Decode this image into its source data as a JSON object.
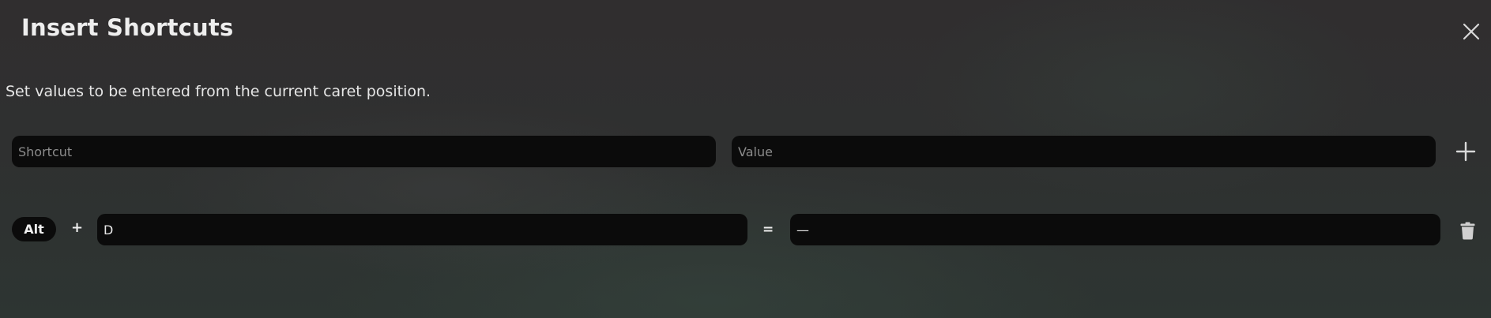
{
  "dialog": {
    "title": "Insert Shortcuts",
    "close_icon": "close-icon",
    "description": "Set values to be entered from the current caret position."
  },
  "new_entry": {
    "shortcut_placeholder": "Shortcut",
    "value_placeholder": "Value",
    "add_icon": "plus-icon"
  },
  "shortcuts": [
    {
      "modifier": "Alt",
      "plus": "+",
      "key": "D",
      "equals": "=",
      "value": "—",
      "delete_icon": "trash-icon"
    }
  ],
  "colors": {
    "field_background": "#0b0b0b",
    "text": "#e8e8e8",
    "placeholder": "#8c8c8c"
  }
}
